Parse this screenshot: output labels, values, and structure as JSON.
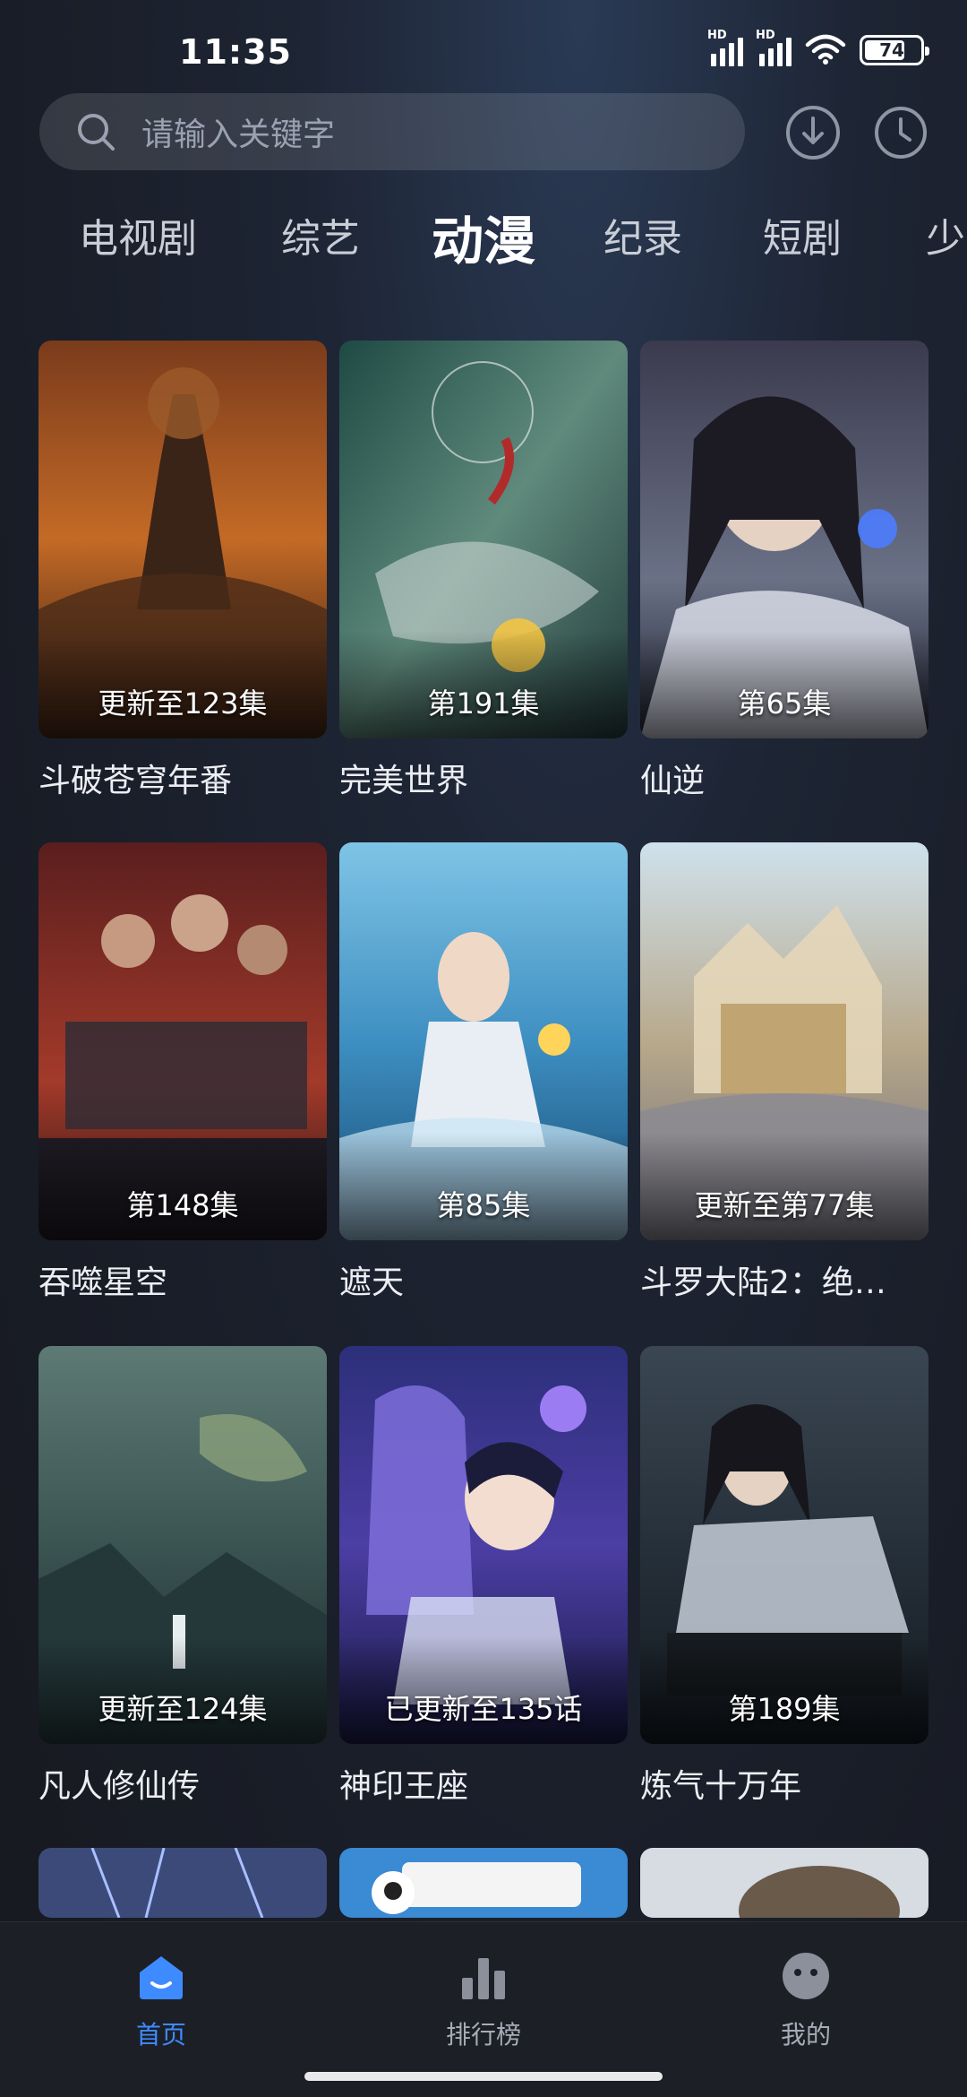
{
  "status_bar": {
    "time": "11:35",
    "battery": "74",
    "battery_level": 0.74,
    "signal_label": "HD"
  },
  "search": {
    "placeholder": "请输入关键字"
  },
  "tabs": [
    {
      "label": "电视剧",
      "active": false
    },
    {
      "label": "综艺",
      "active": false
    },
    {
      "label": "动漫",
      "active": true
    },
    {
      "label": "纪录",
      "active": false
    },
    {
      "label": "短剧",
      "active": false
    },
    {
      "label": "少",
      "active": false
    }
  ],
  "cards": [
    {
      "title": "斗破苍穹年番",
      "episode": "更新至123集"
    },
    {
      "title": "完美世界",
      "episode": "第191集"
    },
    {
      "title": "仙逆",
      "episode": "第65集"
    },
    {
      "title": "吞噬星空",
      "episode": "第148集"
    },
    {
      "title": "遮天",
      "episode": "第85集"
    },
    {
      "title": "斗罗大陆2：绝…",
      "episode": "更新至第77集"
    },
    {
      "title": "凡人修仙传",
      "episode": "更新至124集"
    },
    {
      "title": "神印王座",
      "episode": "已更新至135话"
    },
    {
      "title": "炼气十万年",
      "episode": "第189集"
    }
  ],
  "nav": [
    {
      "label": "首页",
      "icon": "home-icon",
      "active": true
    },
    {
      "label": "排行榜",
      "icon": "ranking-icon",
      "active": false
    },
    {
      "label": "我的",
      "icon": "profile-icon",
      "active": false
    }
  ],
  "colors": {
    "accent": "#3e8bff",
    "background": "#191d27"
  }
}
